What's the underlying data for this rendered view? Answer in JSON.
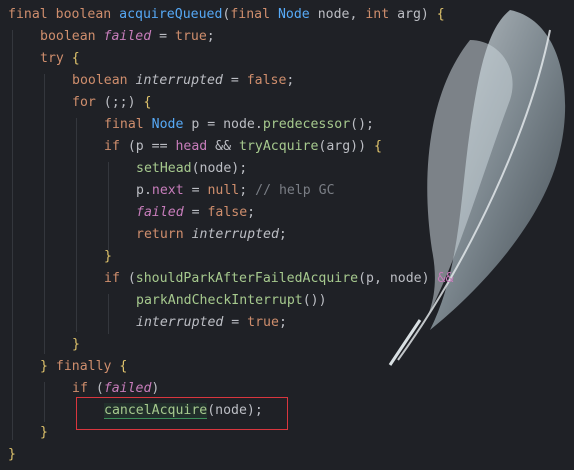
{
  "code_lines": [
    {
      "indent": 0,
      "tokens": [
        [
          "kw",
          "final "
        ],
        [
          "kw",
          "boolean "
        ],
        [
          "fn",
          "acquireQueued"
        ],
        [
          "ty",
          "("
        ],
        [
          "kw",
          "final "
        ],
        [
          "call",
          "Node "
        ],
        [
          "ty",
          "node, "
        ],
        [
          "kw",
          "int "
        ],
        [
          "ty",
          "arg) "
        ],
        [
          "brace",
          "{"
        ]
      ]
    },
    {
      "indent": 1,
      "tokens": [
        [
          "kw",
          "boolean "
        ],
        [
          "italic",
          "failed"
        ],
        [
          "ty",
          " = "
        ],
        [
          "kw",
          "true"
        ],
        [
          "ty",
          ";"
        ]
      ]
    },
    {
      "indent": 1,
      "tokens": [
        [
          "kw",
          "try "
        ],
        [
          "brace",
          "{"
        ]
      ]
    },
    {
      "indent": 2,
      "tokens": [
        [
          "kw",
          "boolean "
        ],
        [
          "it2",
          "interrupted"
        ],
        [
          "ty",
          " = "
        ],
        [
          "kw",
          "false"
        ],
        [
          "ty",
          ";"
        ]
      ]
    },
    {
      "indent": 2,
      "tokens": [
        [
          "kw",
          "for "
        ],
        [
          "ty",
          "(;;) "
        ],
        [
          "brace",
          "{"
        ]
      ]
    },
    {
      "indent": 3,
      "tokens": [
        [
          "kw",
          "final "
        ],
        [
          "call",
          "Node "
        ],
        [
          "ty",
          "p = node."
        ],
        [
          "meth",
          "predecessor"
        ],
        [
          "ty",
          "();"
        ]
      ]
    },
    {
      "indent": 3,
      "tokens": [
        [
          "kw",
          "if "
        ],
        [
          "ty",
          "(p == "
        ],
        [
          "fld",
          "head "
        ],
        [
          "ty",
          "&& "
        ],
        [
          "meth",
          "tryAcquire"
        ],
        [
          "ty",
          "(arg)) "
        ],
        [
          "brace",
          "{"
        ]
      ]
    },
    {
      "indent": 4,
      "tokens": [
        [
          "meth",
          "setHead"
        ],
        [
          "ty",
          "(node);"
        ]
      ]
    },
    {
      "indent": 4,
      "tokens": [
        [
          "ty",
          "p."
        ],
        [
          "fld",
          "next"
        ],
        [
          "ty",
          " = "
        ],
        [
          "kw",
          "null"
        ],
        [
          "ty",
          "; "
        ],
        [
          "cm",
          "// help GC"
        ]
      ]
    },
    {
      "indent": 4,
      "tokens": [
        [
          "italic",
          "failed"
        ],
        [
          "ty",
          " = "
        ],
        [
          "kw",
          "false"
        ],
        [
          "ty",
          ";"
        ]
      ]
    },
    {
      "indent": 4,
      "tokens": [
        [
          "kw",
          "return "
        ],
        [
          "it2",
          "interrupted"
        ],
        [
          "ty",
          ";"
        ]
      ]
    },
    {
      "indent": 3,
      "tokens": [
        [
          "brace",
          "}"
        ]
      ]
    },
    {
      "indent": 3,
      "tokens": [
        [
          "kw",
          "if "
        ],
        [
          "ty",
          "("
        ],
        [
          "meth",
          "shouldParkAfterFailedAcquire"
        ],
        [
          "ty",
          "(p, node) "
        ],
        [
          "fld",
          "&&"
        ]
      ]
    },
    {
      "indent": 4,
      "tokens": [
        [
          "meth",
          "parkAndCheckInterrupt"
        ],
        [
          "ty",
          "())"
        ]
      ]
    },
    {
      "indent": 4,
      "tokens": [
        [
          "it2",
          "interrupted"
        ],
        [
          "ty",
          " = "
        ],
        [
          "kw",
          "true"
        ],
        [
          "ty",
          ";"
        ]
      ]
    },
    {
      "indent": 2,
      "tokens": [
        [
          "brace",
          "}"
        ]
      ]
    },
    {
      "indent": 1,
      "tokens": [
        [
          "brace",
          "} "
        ],
        [
          "kw",
          "finally "
        ],
        [
          "brace",
          "{"
        ]
      ]
    },
    {
      "indent": 2,
      "tokens": [
        [
          "kw",
          "if "
        ],
        [
          "ty",
          "("
        ],
        [
          "italic",
          "failed"
        ],
        [
          "ty",
          ")"
        ]
      ]
    },
    {
      "indent": 3,
      "tokens": [
        [
          "meth",
          "cancelAcquire"
        ],
        [
          "ty",
          "(node);"
        ]
      ]
    },
    {
      "indent": 1,
      "tokens": [
        [
          "brace",
          "}"
        ]
      ]
    },
    {
      "indent": 0,
      "tokens": [
        [
          "brace",
          "}"
        ]
      ]
    }
  ],
  "colors": {
    "background": "#1f2126",
    "keyword": "#cf8e6d",
    "method": "#a6c98e",
    "field": "#c77dbb",
    "comment": "#7a7e85",
    "highlight_box": "#d9363e"
  },
  "highlighted_line_index": 18
}
